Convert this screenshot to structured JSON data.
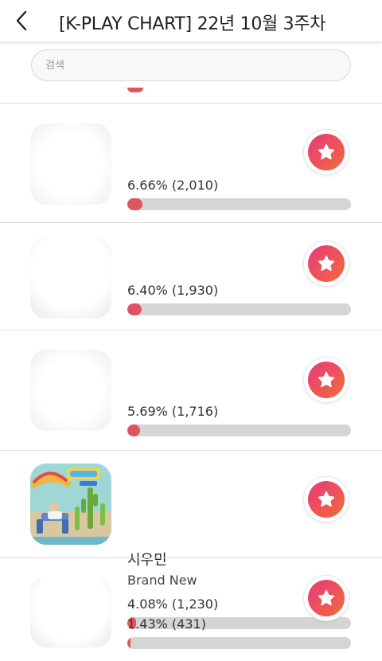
{
  "header": {
    "title": "[K-PLAY CHART] 22년 10월 3주차"
  },
  "search": {
    "placeholder": "검색",
    "value": ""
  },
  "colors": {
    "accent_start": "#e8397b",
    "accent_end": "#f26a3a",
    "bar_fill": "#e05462",
    "bar_track": "#d5d5d5"
  },
  "entries": [
    {
      "artist": "",
      "song": "",
      "stat": "6.66% (2,010)",
      "percent": 6.66
    },
    {
      "artist": "",
      "song": "",
      "stat": "6.40% (1,930)",
      "percent": 6.4
    },
    {
      "artist": "",
      "song": "",
      "stat": "5.69% (1,716)",
      "percent": 5.69
    },
    {
      "artist": "시우민",
      "song": "Brand New",
      "stat": "4.08% (1,230)",
      "percent": 4.08
    },
    {
      "artist": "",
      "song": "",
      "stat": "1.43% (431)",
      "percent": 1.43
    }
  ]
}
